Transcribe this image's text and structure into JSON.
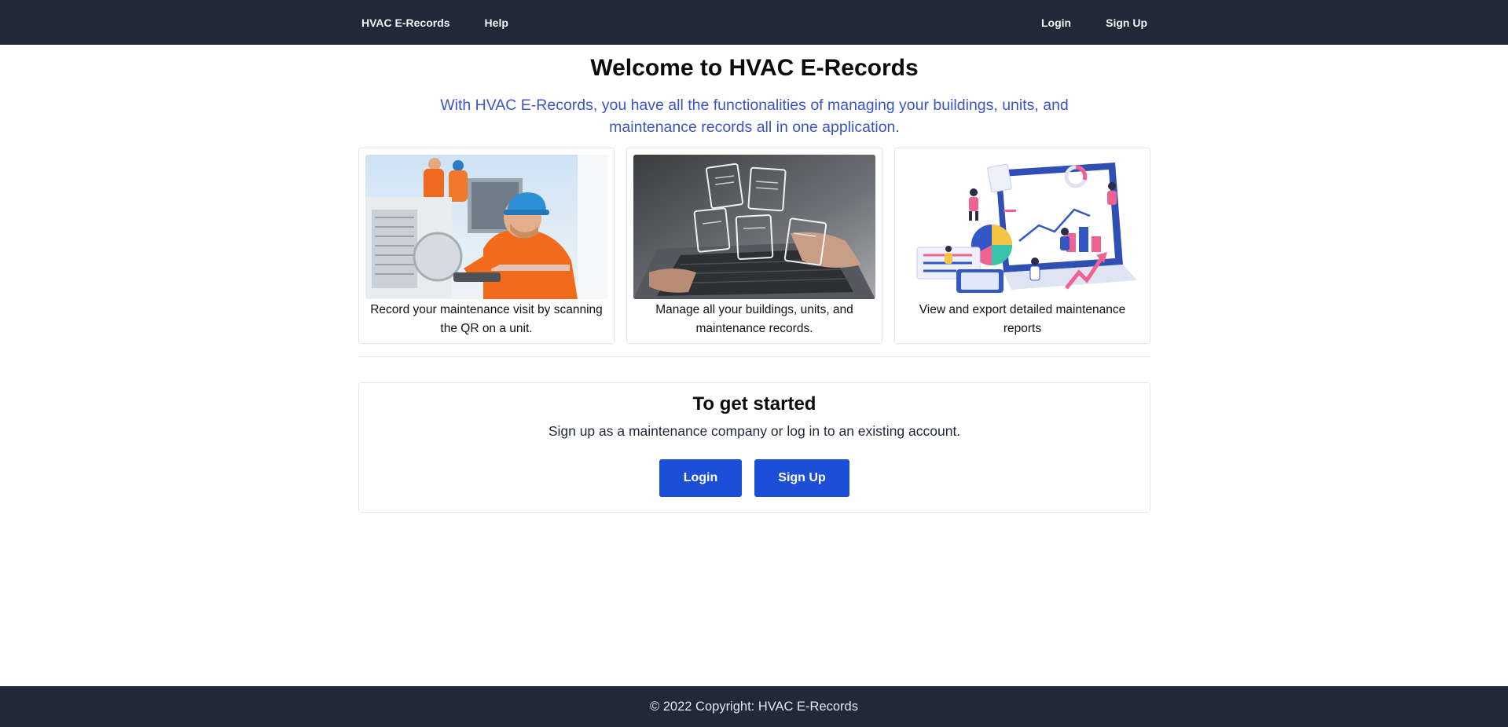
{
  "nav": {
    "brand": "HVAC E-Records",
    "help": "Help",
    "login": "Login",
    "signup": "Sign Up"
  },
  "hero": {
    "title": "Welcome to HVAC E-Records",
    "subtitle": "With HVAC E-Records, you have all the functionalities of managing your buildings, units, and maintenance records all in one application."
  },
  "features": [
    {
      "image": "technician-photo",
      "caption": "Record your maintenance visit by scanning the QR on a unit."
    },
    {
      "image": "laptop-documents-photo",
      "caption": "Manage all your buildings, units, and maintenance records."
    },
    {
      "image": "reports-illustration",
      "caption": "View and export detailed maintenance reports"
    }
  ],
  "get_started": {
    "title": "To get started",
    "text": "Sign up as a maintenance company or log in to an existing account.",
    "login_label": "Login",
    "signup_label": "Sign Up"
  },
  "footer": {
    "copyright": "© 2022 Copyright: HVAC E-Records"
  },
  "colors": {
    "nav_bg": "#1f2937",
    "accent": "#1d4ed8",
    "subtitle": "#3b55c9"
  }
}
